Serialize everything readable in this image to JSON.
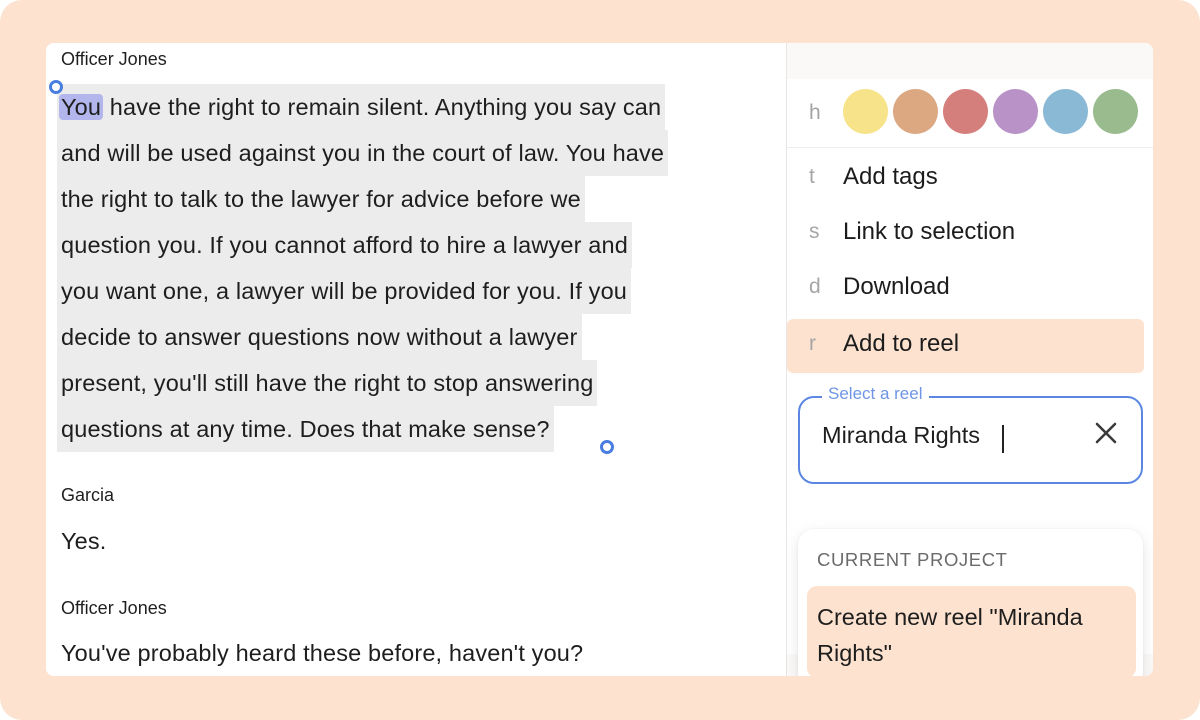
{
  "transcript": {
    "blocks": [
      {
        "speaker": "Officer Jones",
        "selected_word": "You",
        "lines": [
          " have the right to remain silent. Anything you say can",
          "and will be used against you in the court of law. You have",
          "the right to talk to the lawyer for advice before we",
          "question you. If you cannot afford to hire a lawyer and",
          "you want one, a lawyer will be provided for you. If you",
          "decide to answer questions now without a lawyer",
          "present, you'll still have the right to stop answering",
          "questions at any time. Does that make sense?"
        ]
      },
      {
        "speaker": "Garcia",
        "text": "Yes."
      },
      {
        "speaker": "Officer Jones",
        "text": "You've probably heard these before, haven't you?"
      }
    ]
  },
  "menu": {
    "highlight": {
      "key": "h",
      "colors": [
        {
          "name": "yellow",
          "hex": "#f7e38a"
        },
        {
          "name": "orange",
          "hex": "#dba882"
        },
        {
          "name": "red",
          "hex": "#d57f7c"
        },
        {
          "name": "purple",
          "hex": "#b993c8"
        },
        {
          "name": "blue",
          "hex": "#8ab9d6"
        },
        {
          "name": "green",
          "hex": "#99bb8e"
        }
      ]
    },
    "items": [
      {
        "key": "t",
        "label": "Add tags"
      },
      {
        "key": "s",
        "label": "Link to selection"
      },
      {
        "key": "d",
        "label": "Download"
      },
      {
        "key": "r",
        "label": "Add to reel"
      }
    ],
    "reel_select": {
      "label": "Select a reel",
      "value": "Miranda Rights",
      "section_title": "CURRENT PROJECT",
      "option": "Create new reel \"Miranda Rights\""
    }
  }
}
